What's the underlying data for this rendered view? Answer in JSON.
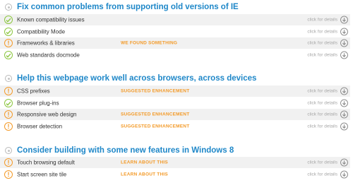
{
  "sections": [
    {
      "title": "Fix common problems from supporting old versions of IE",
      "rows": [
        {
          "label": "Known compatibility issues",
          "status": "ok",
          "tag": "",
          "details": "click for details"
        },
        {
          "label": "Compatibility Mode",
          "status": "ok",
          "tag": "",
          "details": "click for details"
        },
        {
          "label": "Frameworks & libraries",
          "status": "warn",
          "tag": "WE FOUND SOMETHING",
          "details": "click for details"
        },
        {
          "label": "Web standards docmode",
          "status": "ok",
          "tag": "",
          "details": "click for details"
        }
      ]
    },
    {
      "title": "Help this webpage work well across browsers, across devices",
      "rows": [
        {
          "label": "CSS prefixes",
          "status": "warn",
          "tag": "SUGGESTED ENHANCEMENT",
          "details": "click for details"
        },
        {
          "label": "Browser plug-ins",
          "status": "ok",
          "tag": "",
          "details": "click for details"
        },
        {
          "label": "Responsive web design",
          "status": "warn",
          "tag": "SUGGESTED ENHANCEMENT",
          "details": "click for details"
        },
        {
          "label": "Browser detection",
          "status": "warn",
          "tag": "SUGGESTED ENHANCEMENT",
          "details": "click for details"
        }
      ]
    },
    {
      "title": "Consider building with some new features in Windows 8",
      "rows": [
        {
          "label": "Touch browsing default",
          "status": "warn",
          "tag": "LEARN ABOUT THIS",
          "details": "click for details"
        },
        {
          "label": "Start screen site tile",
          "status": "warn",
          "tag": "LEARN ABOUT THIS",
          "details": "click for details"
        }
      ]
    }
  ],
  "colors": {
    "title": "#1e87c8",
    "ok": "#8cc63f",
    "warn": "#f39a28",
    "row_shade": "#f1f1f1"
  },
  "icons": {
    "header": "circle-dot-icon",
    "ok": "check-circle-icon",
    "warn": "exclamation-circle-icon",
    "details": "chevron-down-circle-icon"
  }
}
